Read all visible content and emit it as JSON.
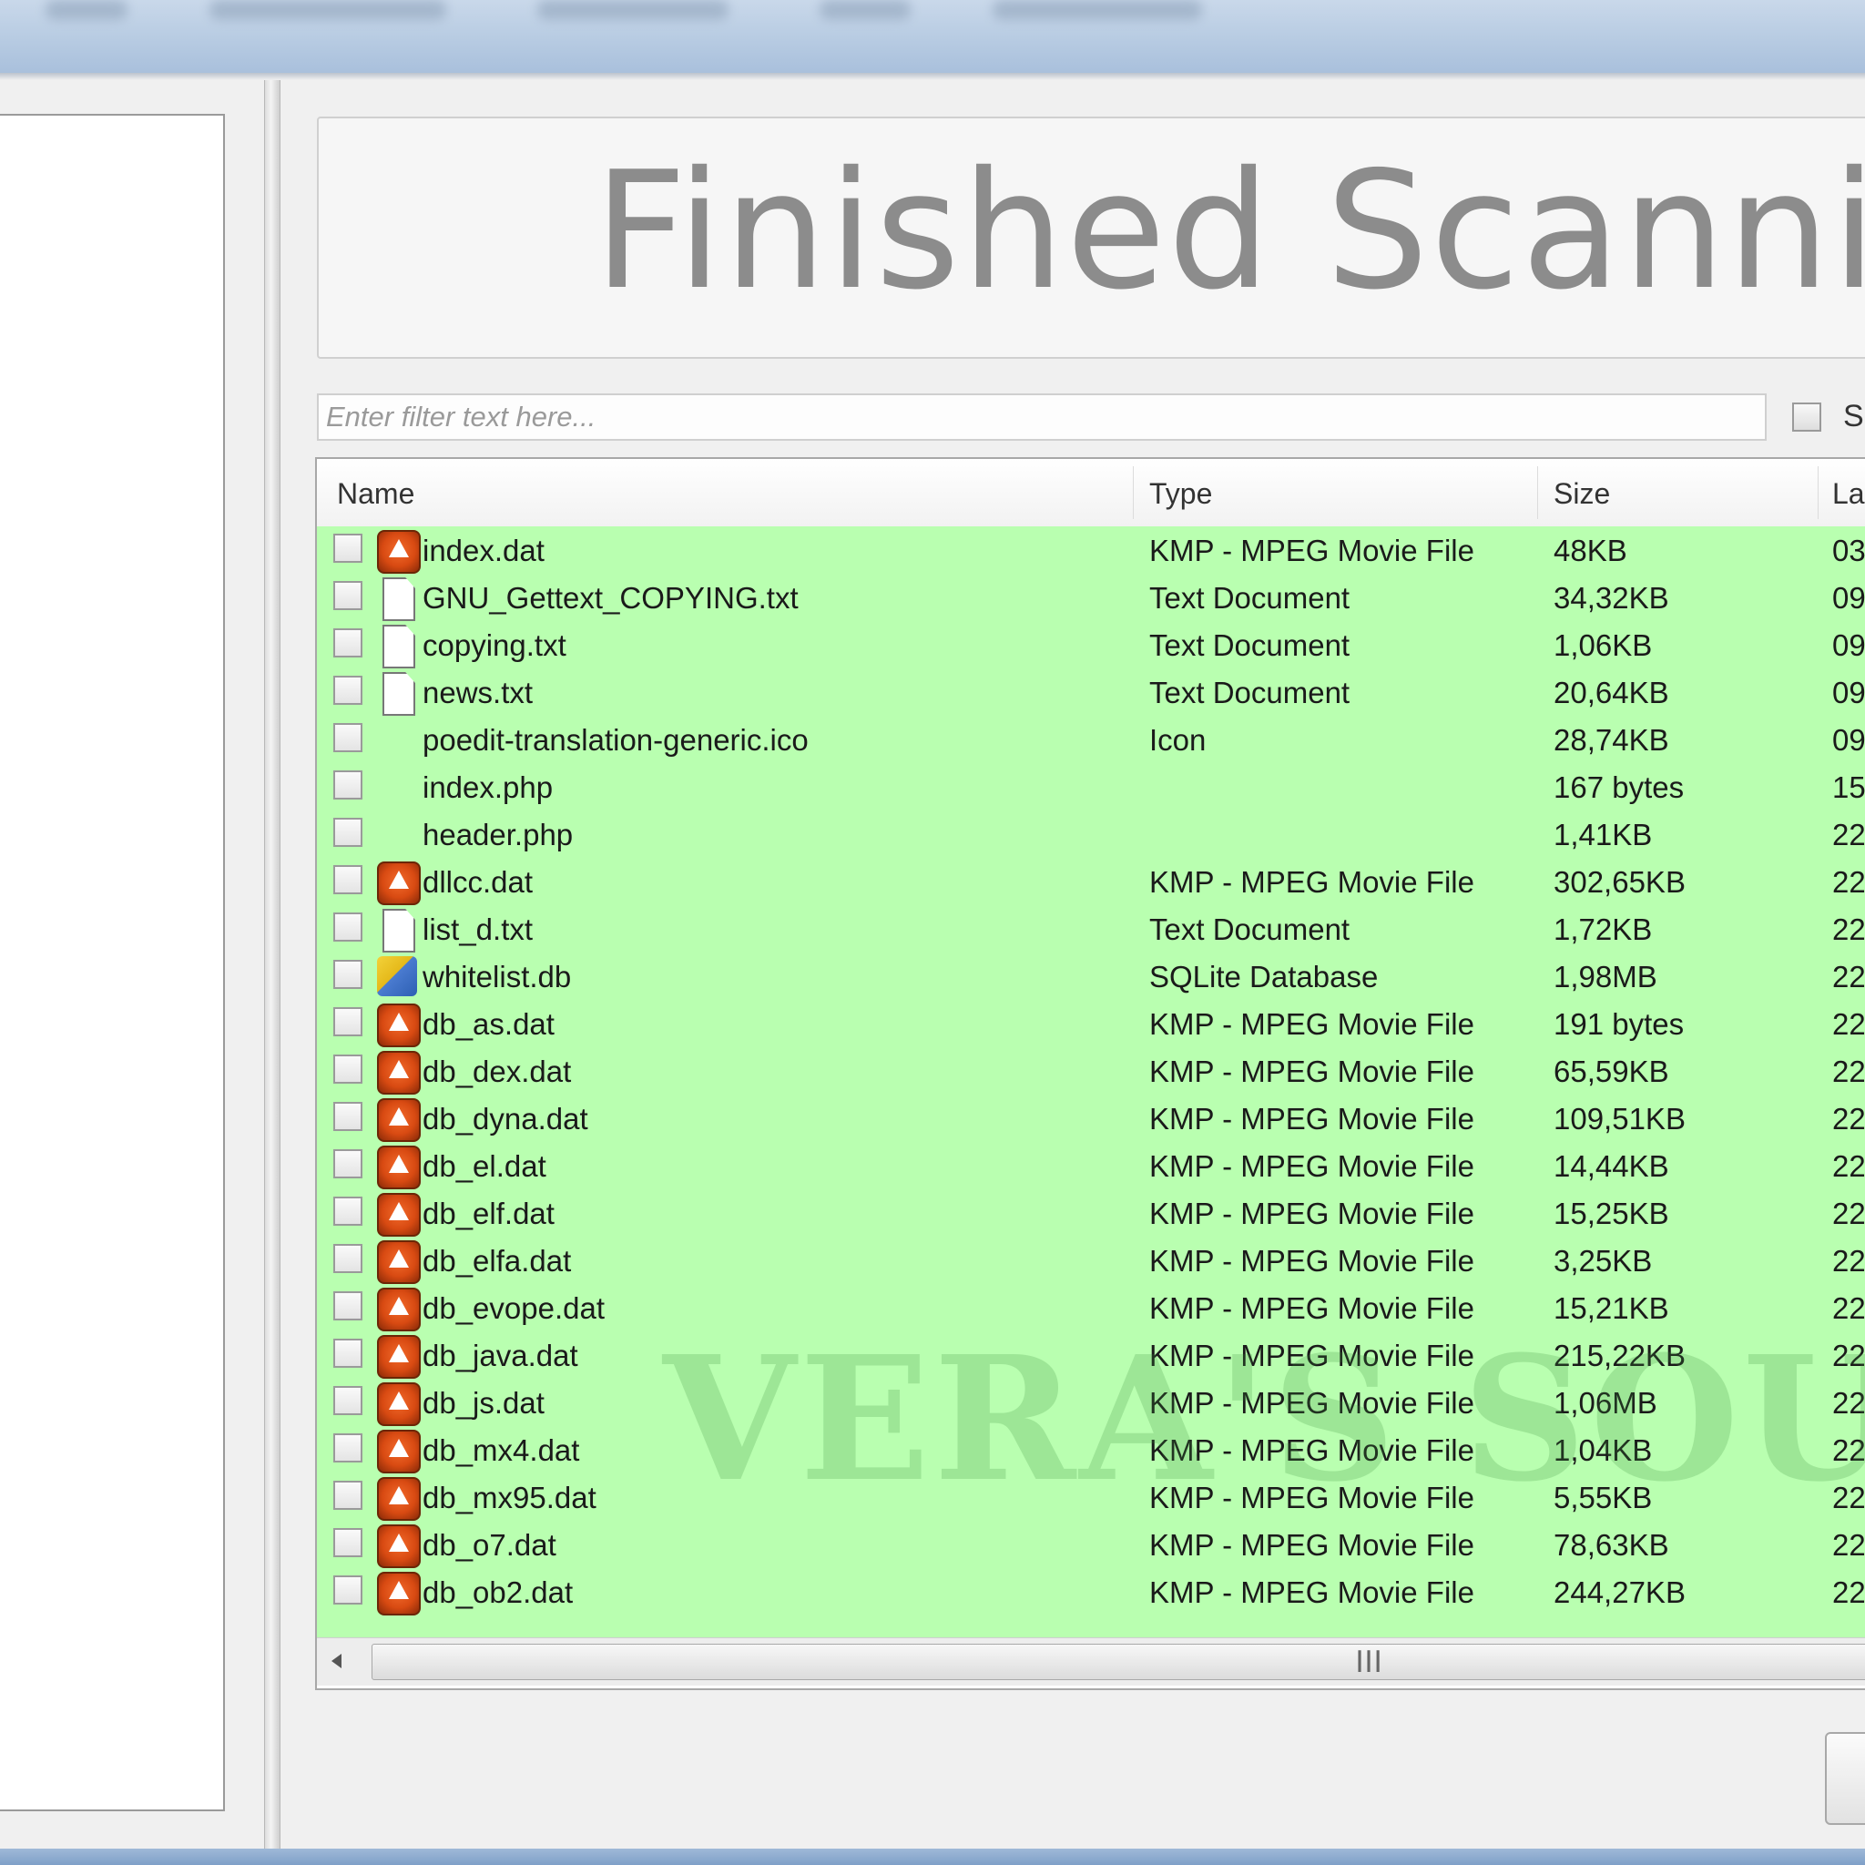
{
  "banner": {
    "title": "Finished Scanni"
  },
  "filter": {
    "placeholder": "Enter filter text here...",
    "select_label": "S"
  },
  "table": {
    "columns": {
      "name": "Name",
      "type": "Type",
      "size": "Size",
      "date": "La"
    },
    "rows": [
      {
        "name": "index.dat",
        "type": "KMP - MPEG Movie File",
        "size": "48KB",
        "date": "03",
        "icon": "kmp-file-icon"
      },
      {
        "name": "GNU_Gettext_COPYING.txt",
        "type": "Text Document",
        "size": "34,32KB",
        "date": "09",
        "icon": "text-file-icon"
      },
      {
        "name": "copying.txt",
        "type": "Text Document",
        "size": "1,06KB",
        "date": "09",
        "icon": "text-file-icon"
      },
      {
        "name": "news.txt",
        "type": "Text Document",
        "size": "20,64KB",
        "date": "09",
        "icon": "text-file-icon"
      },
      {
        "name": "poedit-translation-generic.ico",
        "type": "Icon",
        "size": "28,74KB",
        "date": "09",
        "icon": "none"
      },
      {
        "name": "index.php",
        "type": "",
        "size": "167 bytes",
        "date": "15",
        "icon": "none"
      },
      {
        "name": "header.php",
        "type": "",
        "size": "1,41KB",
        "date": "22",
        "icon": "none"
      },
      {
        "name": "dllcc.dat",
        "type": "KMP - MPEG Movie File",
        "size": "302,65KB",
        "date": "22",
        "icon": "kmp-file-icon"
      },
      {
        "name": "list_d.txt",
        "type": "Text Document",
        "size": "1,72KB",
        "date": "22",
        "icon": "text-file-icon"
      },
      {
        "name": "whitelist.db",
        "type": "SQLite Database",
        "size": "1,98MB",
        "date": "22",
        "icon": "database-file-icon"
      },
      {
        "name": "db_as.dat",
        "type": "KMP - MPEG Movie File",
        "size": "191 bytes",
        "date": "22",
        "icon": "kmp-file-icon"
      },
      {
        "name": "db_dex.dat",
        "type": "KMP - MPEG Movie File",
        "size": "65,59KB",
        "date": "22",
        "icon": "kmp-file-icon"
      },
      {
        "name": "db_dyna.dat",
        "type": "KMP - MPEG Movie File",
        "size": "109,51KB",
        "date": "22",
        "icon": "kmp-file-icon"
      },
      {
        "name": "db_el.dat",
        "type": "KMP - MPEG Movie File",
        "size": "14,44KB",
        "date": "22",
        "icon": "kmp-file-icon"
      },
      {
        "name": "db_elf.dat",
        "type": "KMP - MPEG Movie File",
        "size": "15,25KB",
        "date": "22",
        "icon": "kmp-file-icon"
      },
      {
        "name": "db_elfa.dat",
        "type": "KMP - MPEG Movie File",
        "size": "3,25KB",
        "date": "22",
        "icon": "kmp-file-icon"
      },
      {
        "name": "db_evope.dat",
        "type": "KMP - MPEG Movie File",
        "size": "15,21KB",
        "date": "22",
        "icon": "kmp-file-icon"
      },
      {
        "name": "db_java.dat",
        "type": "KMP - MPEG Movie File",
        "size": "215,22KB",
        "date": "22",
        "icon": "kmp-file-icon"
      },
      {
        "name": "db_js.dat",
        "type": "KMP - MPEG Movie File",
        "size": "1,06MB",
        "date": "22",
        "icon": "kmp-file-icon"
      },
      {
        "name": "db_mx4.dat",
        "type": "KMP - MPEG Movie File",
        "size": "1,04KB",
        "date": "22",
        "icon": "kmp-file-icon"
      },
      {
        "name": "db_mx95.dat",
        "type": "KMP - MPEG Movie File",
        "size": "5,55KB",
        "date": "22",
        "icon": "kmp-file-icon"
      },
      {
        "name": "db_o7.dat",
        "type": "KMP - MPEG Movie File",
        "size": "78,63KB",
        "date": "22",
        "icon": "kmp-file-icon"
      },
      {
        "name": "db_ob2.dat",
        "type": "KMP - MPEG Movie File",
        "size": "244,27KB",
        "date": "22",
        "icon": "kmp-file-icon"
      }
    ]
  },
  "watermark": {
    "text": "VERA'S SOUL"
  },
  "colors": {
    "row_highlight": "#b9ffb0",
    "banner_text": "#8c8c8c",
    "kmp_icon": "#e0561a"
  }
}
